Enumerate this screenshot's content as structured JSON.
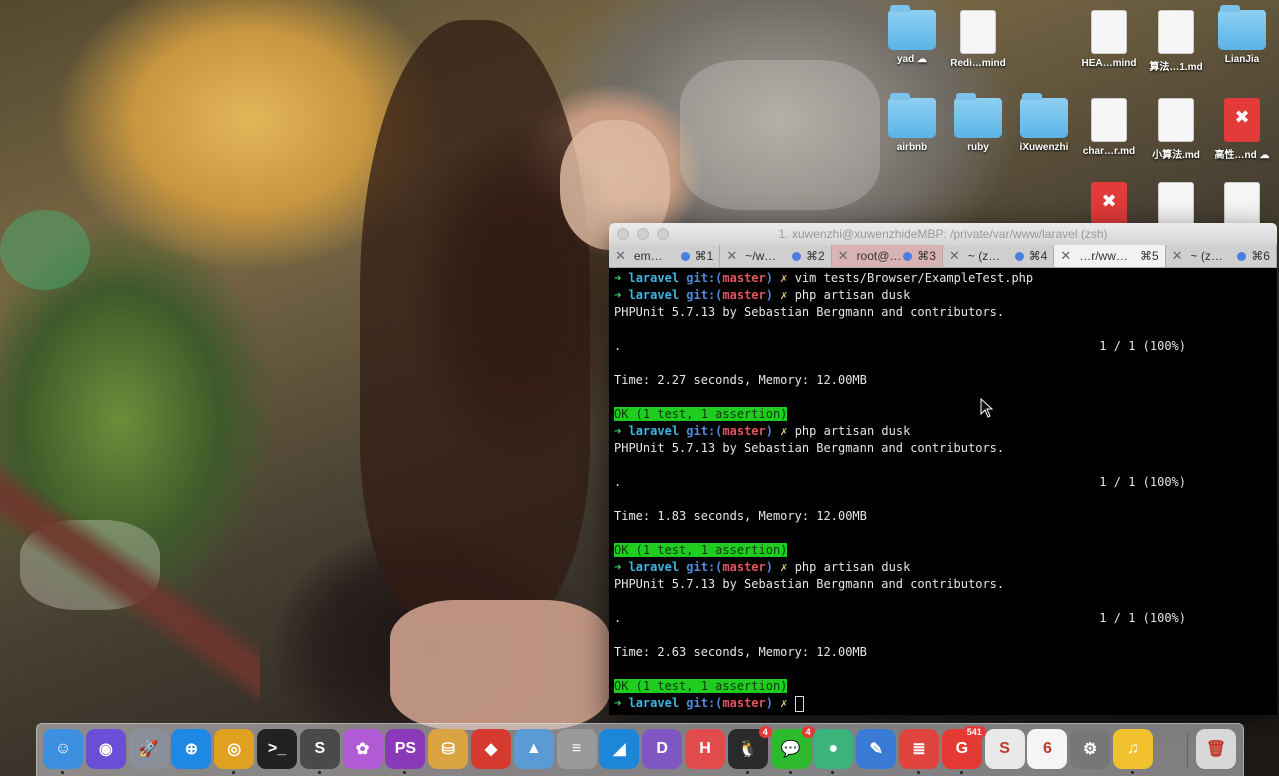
{
  "desktop_icons": [
    {
      "label": "yad ☁︎",
      "kind": "folder"
    },
    {
      "label": "Redi…mind",
      "kind": "doc"
    },
    {
      "label": "HEA…mind",
      "kind": "doc"
    },
    {
      "label": "算法…1.md",
      "kind": "doc"
    },
    {
      "label": "LianJia",
      "kind": "folder"
    },
    {
      "label": "airbnb",
      "kind": "folder"
    },
    {
      "label": "ruby",
      "kind": "folder"
    },
    {
      "label": "iXuwenzhi",
      "kind": "folder"
    },
    {
      "label": "char…r.md",
      "kind": "doc"
    },
    {
      "label": "小算法.md",
      "kind": "doc"
    },
    {
      "label": "高性…nd ☁︎",
      "kind": "xmind"
    },
    {
      "label": "",
      "kind": "xmind"
    },
    {
      "label": "",
      "kind": "doc"
    },
    {
      "label": "",
      "kind": "doc"
    }
  ],
  "terminal": {
    "title": "1. xuwenzhi@xuwenzhideMBP: /private/var/www/laravel (zsh)",
    "tabs": [
      {
        "title": "em…",
        "shortcut": "⌘1",
        "state": ""
      },
      {
        "title": "~/w…",
        "shortcut": "⌘2",
        "state": ""
      },
      {
        "title": "root@…",
        "shortcut": "⌘3",
        "state": "warm"
      },
      {
        "title": "~ (z…",
        "shortcut": "⌘4",
        "state": ""
      },
      {
        "title": "…r/ww…",
        "shortcut": "⌘5",
        "state": "active"
      },
      {
        "title": "~ (z…",
        "shortcut": "⌘6",
        "state": ""
      }
    ],
    "prompt": {
      "arrow": "➜",
      "dir": "laravel",
      "git": "git:(",
      "branch": "master",
      "git_close": ")",
      "dirty": "✗"
    },
    "lines": [
      {
        "type": "cmd",
        "text": "vim tests/Browser/ExampleTest.php"
      },
      {
        "type": "cmd",
        "text": "php artisan dusk"
      },
      {
        "type": "out",
        "text": "PHPUnit 5.7.13 by Sebastian Bergmann and contributors."
      },
      {
        "type": "out",
        "text": ""
      },
      {
        "type": "progress",
        "text": ".",
        "right": "1 / 1 (100%)"
      },
      {
        "type": "out",
        "text": ""
      },
      {
        "type": "out",
        "text": "Time: 2.27 seconds, Memory: 12.00MB"
      },
      {
        "type": "out",
        "text": ""
      },
      {
        "type": "ok",
        "text": "OK (1 test, 1 assertion)"
      },
      {
        "type": "cmd",
        "text": "php artisan dusk"
      },
      {
        "type": "out",
        "text": "PHPUnit 5.7.13 by Sebastian Bergmann and contributors."
      },
      {
        "type": "out",
        "text": ""
      },
      {
        "type": "progress",
        "text": ".",
        "right": "1 / 1 (100%)"
      },
      {
        "type": "out",
        "text": ""
      },
      {
        "type": "out",
        "text": "Time: 1.83 seconds, Memory: 12.00MB"
      },
      {
        "type": "out",
        "text": ""
      },
      {
        "type": "ok",
        "text": "OK (1 test, 1 assertion)"
      },
      {
        "type": "cmd",
        "text": "php artisan dusk"
      },
      {
        "type": "out",
        "text": "PHPUnit 5.7.13 by Sebastian Bergmann and contributors."
      },
      {
        "type": "out",
        "text": ""
      },
      {
        "type": "progress",
        "text": ".",
        "right": "1 / 1 (100%)"
      },
      {
        "type": "out",
        "text": ""
      },
      {
        "type": "out",
        "text": "Time: 2.63 seconds, Memory: 12.00MB"
      },
      {
        "type": "out",
        "text": ""
      },
      {
        "type": "ok",
        "text": "OK (1 test, 1 assertion)"
      },
      {
        "type": "cursor",
        "text": ""
      }
    ]
  },
  "dock": [
    {
      "name": "finder-icon",
      "glyph": "☺",
      "color": "#3d8fe0",
      "running": true
    },
    {
      "name": "siri-icon",
      "glyph": "◉",
      "color": "#6a4fd6",
      "running": false
    },
    {
      "name": "launchpad-icon",
      "glyph": "🚀",
      "color": "#8a8f99",
      "running": false
    },
    {
      "name": "safari-icon",
      "glyph": "⊕",
      "color": "#1e88e5",
      "running": false
    },
    {
      "name": "chrome-icon",
      "glyph": "◎",
      "color": "#e0a020",
      "running": true
    },
    {
      "name": "terminal-icon",
      "glyph": ">_",
      "color": "#222222",
      "running": false
    },
    {
      "name": "sublime-icon",
      "glyph": "S",
      "color": "#4a4a4a",
      "running": true
    },
    {
      "name": "flower-app-icon",
      "glyph": "✿",
      "color": "#b15ad6",
      "running": false
    },
    {
      "name": "phpstorm-icon",
      "glyph": "PS",
      "color": "#8a3ab9",
      "running": true
    },
    {
      "name": "sequel-pro-icon",
      "glyph": "⛁",
      "color": "#d9a441",
      "running": false
    },
    {
      "name": "redis-icon",
      "glyph": "◆",
      "color": "#d63a2f",
      "running": false
    },
    {
      "name": "elephant-app-icon",
      "glyph": "▲",
      "color": "#5b9bd5",
      "running": false
    },
    {
      "name": "database-icon",
      "glyph": "≡",
      "color": "#9a9a9a",
      "running": false
    },
    {
      "name": "shark-app-icon",
      "glyph": "◢",
      "color": "#1c86d9",
      "running": false
    },
    {
      "name": "dash-icon",
      "glyph": "D",
      "color": "#7e57c2",
      "running": false
    },
    {
      "name": "h-app-icon",
      "glyph": "H",
      "color": "#e24b4b",
      "running": false
    },
    {
      "name": "qq-icon",
      "glyph": "🐧",
      "color": "#2a2a2a",
      "running": true,
      "badge": "4"
    },
    {
      "name": "wechat-icon",
      "glyph": "💬",
      "color": "#2dbb2d",
      "running": true,
      "badge": "4"
    },
    {
      "name": "green-app-icon",
      "glyph": "●",
      "color": "#3bb37a",
      "running": true
    },
    {
      "name": "pen-app-icon",
      "glyph": "✎",
      "color": "#3a7bd5",
      "running": false
    },
    {
      "name": "todoist-icon",
      "glyph": "≣",
      "color": "#e0443e",
      "running": true
    },
    {
      "name": "g-app-icon",
      "glyph": "G",
      "color": "#e53935",
      "running": true,
      "badge": "541"
    },
    {
      "name": "slack-icon",
      "glyph": "S",
      "color": "#e9e9e9",
      "running": false
    },
    {
      "name": "calendar-icon",
      "glyph": "6",
      "color": "#f5f5f5",
      "running": false
    },
    {
      "name": "system-preferences-icon",
      "glyph": "⚙",
      "color": "#777777",
      "running": false
    },
    {
      "name": "music-app-icon",
      "glyph": "♫",
      "color": "#f2c12e",
      "running": true
    },
    {
      "name": "trash-icon",
      "glyph": "🗑",
      "color": "#d8d8d8",
      "running": false
    }
  ]
}
